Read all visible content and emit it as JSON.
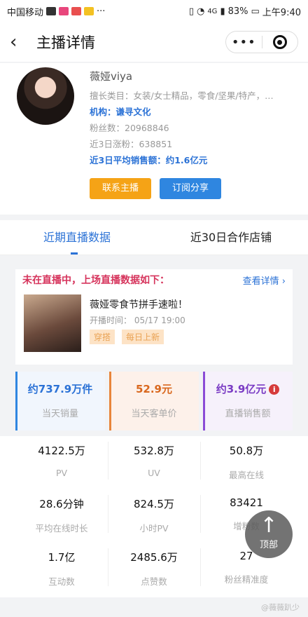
{
  "status_bar": {
    "carrier": "中国移动",
    "battery": "83%",
    "time": "上午9:40",
    "network": "4G",
    "more": "···"
  },
  "nav": {
    "back_icon": "chevron-left-icon",
    "title": "主播详情",
    "menu_dots": "•••"
  },
  "profile": {
    "name": "薇娅viya",
    "category": "擅长类目：女装/女士精品，零食/坚果/特产，…",
    "agency": "机构：谦寻文化",
    "followers": "粉丝数：20968846",
    "growth_3d": "近3日涨粉：638851",
    "avg_sales_3d": "近3日平均销售额：约1.6亿元",
    "contact_button": "联系主播",
    "subscribe_button": "订阅分享"
  },
  "tabs": [
    {
      "label": "近期直播数据",
      "active": true
    },
    {
      "label": "近30日合作店铺",
      "active": false
    }
  ],
  "live_card": {
    "status": "未在直播中，上场直播数据如下：",
    "detail_link": "查看详情 ›",
    "title": "薇娅零食节拼手速啦！",
    "start_time": "开播时间：  05/17 19:00",
    "tags": [
      "穿搭",
      "每日上新"
    ]
  },
  "top_metrics": [
    {
      "value": "约737.9万件",
      "label": "当天销量"
    },
    {
      "value": "52.9元",
      "label": "当天客单价"
    },
    {
      "value": "约3.9亿元",
      "label": "直播销售额",
      "info_icon": "i"
    }
  ],
  "stats_grid": [
    [
      {
        "value": "4122.5万",
        "label": "PV"
      },
      {
        "value": "532.8万",
        "label": "UV"
      },
      {
        "value": "50.8万",
        "label": "最高在线"
      }
    ],
    [
      {
        "value": "28.6分钟",
        "label": "平均在线时长"
      },
      {
        "value": "824.5万",
        "label": "小时PV"
      },
      {
        "value": "83421",
        "label": "增粉数"
      }
    ],
    [
      {
        "value": "1.7亿",
        "label": "互动数"
      },
      {
        "value": "2485.6万",
        "label": "点赞数"
      },
      {
        "value": "27",
        "label": "粉丝精准度"
      }
    ]
  ],
  "back_to_top": {
    "arrow": "↑",
    "label": "顶部"
  },
  "watermark": "@薇薇趴少",
  "colors": {
    "accent_blue": "#2b72d6",
    "orange": "#f5a316",
    "pink": "#d6345c"
  }
}
